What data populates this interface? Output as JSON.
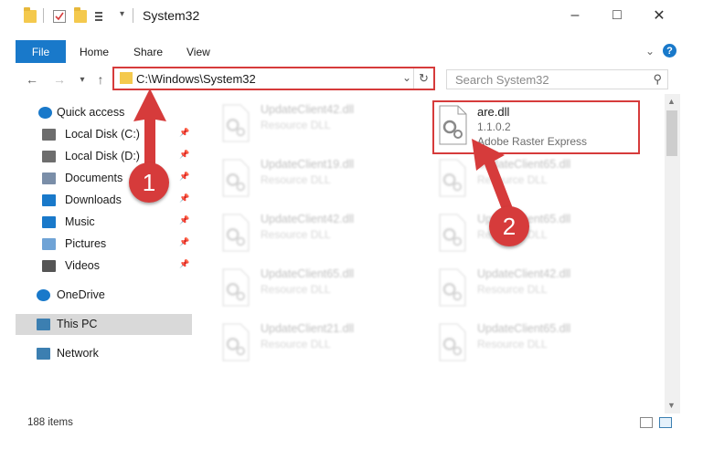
{
  "window": {
    "title": "System32",
    "controls": {
      "minimize": "–",
      "maximize": "□",
      "close": "✕"
    }
  },
  "ribbon": {
    "tabs": [
      "File",
      "Home",
      "Share",
      "View"
    ],
    "help": "?"
  },
  "navigation": {
    "address": "C:\\Windows\\System32",
    "search_placeholder": "Search System32"
  },
  "sidebar": {
    "items": [
      {
        "label": "Quick access",
        "icon": "star-icon",
        "pinned": false
      },
      {
        "label": "Local Disk (C:)",
        "icon": "drive-icon",
        "pinned": true
      },
      {
        "label": "Local Disk (D:)",
        "icon": "drive-icon",
        "pinned": true
      },
      {
        "label": "Documents",
        "icon": "documents-icon",
        "pinned": true
      },
      {
        "label": "Downloads",
        "icon": "download-icon",
        "pinned": true
      },
      {
        "label": "Music",
        "icon": "music-icon",
        "pinned": true
      },
      {
        "label": "Pictures",
        "icon": "pictures-icon",
        "pinned": true
      },
      {
        "label": "Videos",
        "icon": "videos-icon",
        "pinned": true
      },
      {
        "label": "OneDrive",
        "icon": "cloud-icon",
        "pinned": false
      },
      {
        "label": "This PC",
        "icon": "computer-icon",
        "pinned": false,
        "selected": true
      },
      {
        "label": "Network",
        "icon": "network-icon",
        "pinned": false
      }
    ],
    "pin_glyph": "📌"
  },
  "files": {
    "selected": {
      "name": "are.dll",
      "version": "1.1.0.2",
      "description": "Adobe Raster Express"
    },
    "background": [
      {
        "name": "UpdateClient42.dll",
        "type": "Resource DLL"
      },
      {
        "name": "UpdateClient19.dll",
        "type": "Resource DLL"
      },
      {
        "name": "UpdateClient65.dll",
        "type": "Resource DLL"
      },
      {
        "name": "UpdateClient42.dll",
        "type": "Resource DLL"
      },
      {
        "name": "UpdateClient65.dll",
        "type": "Resource DLL"
      },
      {
        "name": "UpdateClient65.dll",
        "type": "Resource DLL"
      },
      {
        "name": "UpdateClient42.dll",
        "type": "Resource DLL"
      },
      {
        "name": "UpdateClient21.dll",
        "type": "Resource DLL"
      },
      {
        "name": "UpdateClient65.dll",
        "type": "Resource DLL"
      }
    ]
  },
  "status": {
    "item_count": "188 items"
  },
  "annotations": {
    "step1": "1",
    "step2": "2"
  },
  "colors": {
    "accent": "#1979ca",
    "annotation_red": "#d63b3b",
    "selected_bg": "#d9d9d9"
  }
}
